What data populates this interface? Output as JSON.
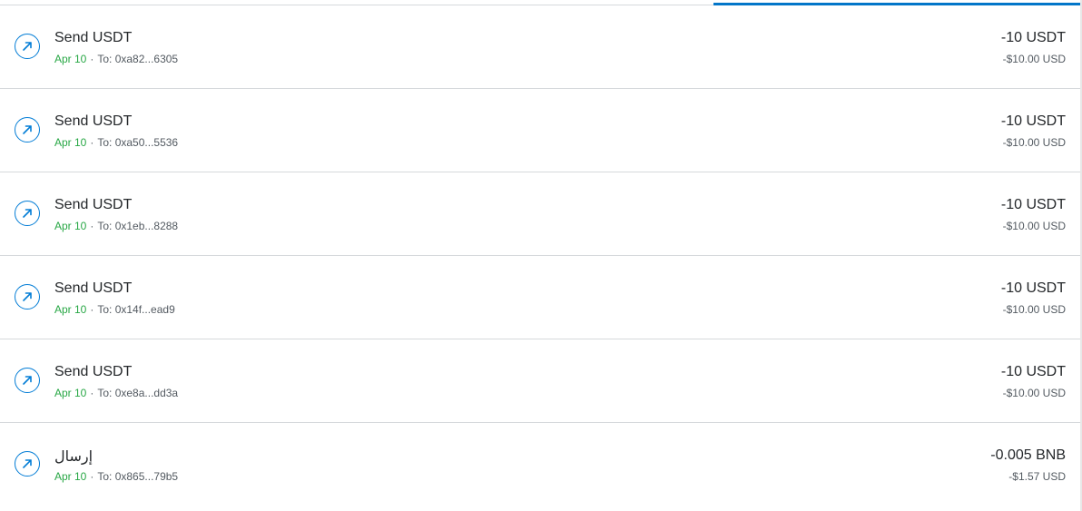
{
  "colors": {
    "accent": "#037dd6",
    "tab_indicator": "#0376c9",
    "date_green": "#28a745",
    "text_primary": "#24272a",
    "text_secondary": "#535a61",
    "divider": "#d6d9dc"
  },
  "icons": {
    "send": "arrow-up-right-icon"
  },
  "transactions": [
    {
      "title": "Send USDT",
      "date": "Apr 10",
      "separator": "·",
      "recipient": "To: 0xa82...6305",
      "amount": "-10 USDT",
      "fiat": "-$10.00 USD"
    },
    {
      "title": "Send USDT",
      "date": "Apr 10",
      "separator": "·",
      "recipient": "To: 0xa50...5536",
      "amount": "-10 USDT",
      "fiat": "-$10.00 USD"
    },
    {
      "title": "Send USDT",
      "date": "Apr 10",
      "separator": "·",
      "recipient": "To: 0x1eb...8288",
      "amount": "-10 USDT",
      "fiat": "-$10.00 USD"
    },
    {
      "title": "Send USDT",
      "date": "Apr 10",
      "separator": "·",
      "recipient": "To: 0x14f...ead9",
      "amount": "-10 USDT",
      "fiat": "-$10.00 USD"
    },
    {
      "title": "Send USDT",
      "date": "Apr 10",
      "separator": "·",
      "recipient": "To: 0xe8a...dd3a",
      "amount": "-10 USDT",
      "fiat": "-$10.00 USD"
    },
    {
      "title": "إرسال",
      "date": "Apr 10",
      "separator": "·",
      "recipient": "To: 0x865...79b5",
      "amount": "-0.005 BNB",
      "fiat": "-$1.57 USD"
    }
  ]
}
